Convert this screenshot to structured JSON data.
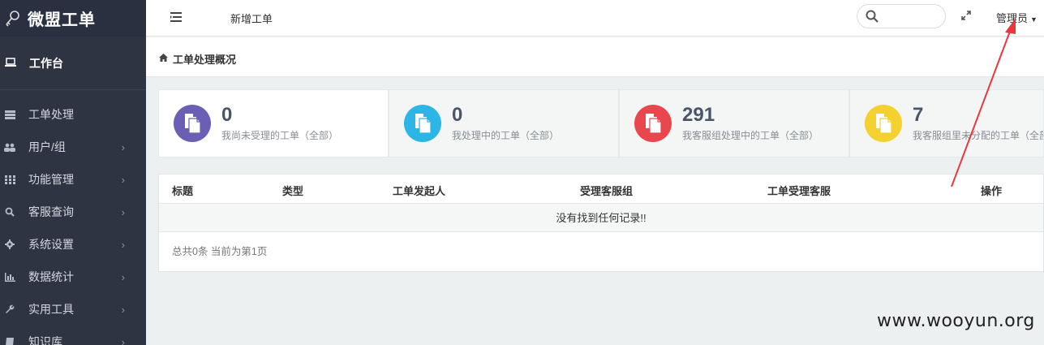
{
  "brand": {
    "title": "微盟工单",
    "logo_icon": "user-key-icon"
  },
  "sidebar": {
    "active": {
      "label": "工作台",
      "icon": "laptop-icon"
    },
    "items": [
      {
        "label": "工单处理",
        "icon": "tasks-icon"
      },
      {
        "label": "用户/组",
        "icon": "users-icon"
      },
      {
        "label": "功能管理",
        "icon": "grid-icon"
      },
      {
        "label": "客服查询",
        "icon": "search-icon"
      },
      {
        "label": "系统设置",
        "icon": "gear-icon"
      },
      {
        "label": "数据统计",
        "icon": "bar-chart-icon"
      },
      {
        "label": "实用工具",
        "icon": "wrench-icon"
      },
      {
        "label": "知识库",
        "icon": "book-icon"
      }
    ],
    "chevron": "›"
  },
  "topbar": {
    "new_order": "新增工单",
    "search_placeholder": "",
    "admin": "管理员"
  },
  "breadcrumb": {
    "title": "工单处理概况"
  },
  "stats": [
    {
      "value": "0",
      "desc": "我尚未受理的工单（全部）",
      "color": "#6a5fb5"
    },
    {
      "value": "0",
      "desc": "我处理中的工单（全部）",
      "color": "#2bb6e6"
    },
    {
      "value": "291",
      "desc": "我客服组处理中的工单（全部）",
      "color": "#e9474e"
    },
    {
      "value": "7",
      "desc": "我客服组里未分配的工单（全部）",
      "color": "#f5d130"
    }
  ],
  "table": {
    "headers": [
      "标题",
      "类型",
      "工单发起人",
      "受理客服组",
      "工单受理客服",
      "操作"
    ],
    "empty_text": "没有找到任何记录!!",
    "pager_text": "总共0条 当前为第1页"
  },
  "watermark": "www.wooyun.org",
  "colors": {
    "sidebar_bg": "#2f3443",
    "annotation_arrow": "#e8383d"
  }
}
